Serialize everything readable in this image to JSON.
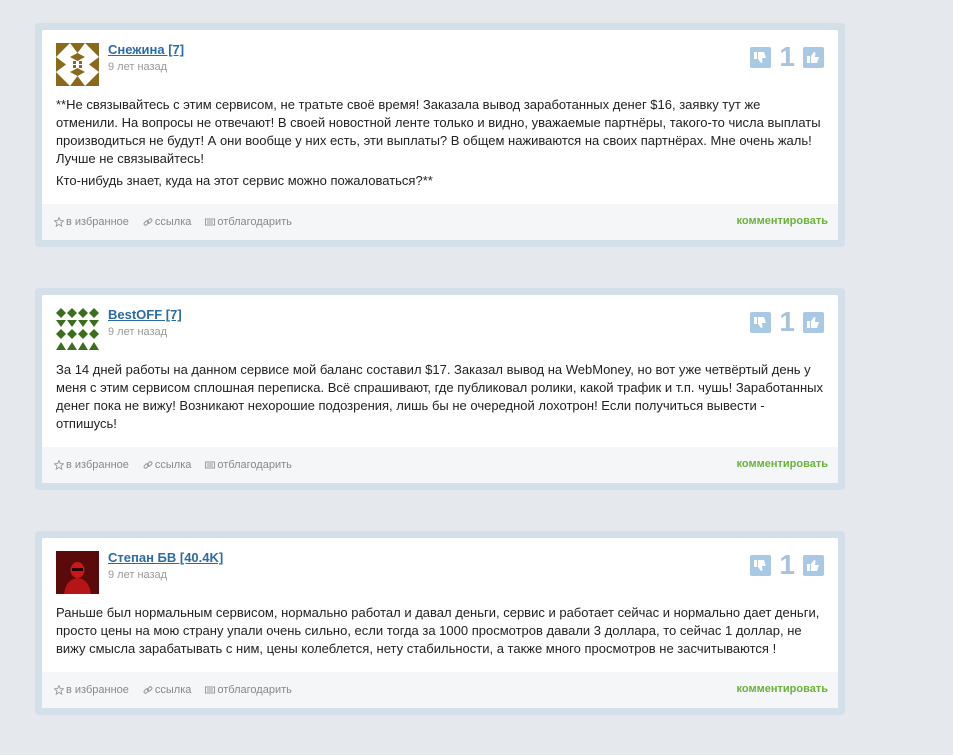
{
  "colors": {
    "page_bg": "#e5e9ee",
    "card_frame": "#d3dfe9",
    "author_link": "#2b6ca8",
    "vote_button": "#a8c8e4",
    "reply_link": "#6cb13c"
  },
  "footer_labels": {
    "favorite": "в избранное",
    "link": "ссылка",
    "thank": "отблагодарить",
    "reply": "комментировать"
  },
  "comments": [
    {
      "author": "Снежина [7]",
      "date": "9 лет назад",
      "score": "1",
      "avatar_icon": "identicon-brown",
      "paragraphs": [
        "**Не связывайтесь с этим сервисом, не тратьте своё время! Заказала вывод заработанных денег $16, заявку тут же отменили. На вопросы не отвечают! В своей новостной ленте только и видно, уважаемые партнёры, такого-то числа выплаты производиться не будут! А они вообще у них есть, эти выплаты? В общем наживаются на своих партнёрах. Мне очень жаль! Лучше не связывайтесь!",
        "Кто-нибудь знает, куда на этот сервис можно пожаловаться?**"
      ]
    },
    {
      "author": "BestOFF [7]",
      "date": "9 лет назад",
      "score": "1",
      "avatar_icon": "identicon-green",
      "paragraphs": [
        "За 14 дней работы на данном сервисе мой баланс составил $17. Заказал вывод на WebMoney, но вот уже четвёртый день у меня с этим сервисом сплошная переписка. Всё спрашивают, где публиковал ролики, какой трафик и т.п. чушь! Заработанных денег пока не вижу! Возникают нехорошие подозрения, лишь бы не очередной лохотрон! Если получиться вывести - отпишусь!"
      ]
    },
    {
      "author": "Степан БВ [40.4K]",
      "date": "9 лет назад",
      "score": "1",
      "avatar_icon": "avatar-red-figure",
      "paragraphs": [
        "Раньше был нормальным сервисом, нормально работал и давал деньги, сервис и работает сейчас и нормально дает деньги, просто цены на мою страну упали очень сильно, если тогда за 1000 просмотров давали 3 доллара, то сейчас 1 доллар, не вижу смысла зарабатывать с ним, цены колеблется, нету стабильности, а также много просмотров не засчитываются !"
      ]
    }
  ]
}
